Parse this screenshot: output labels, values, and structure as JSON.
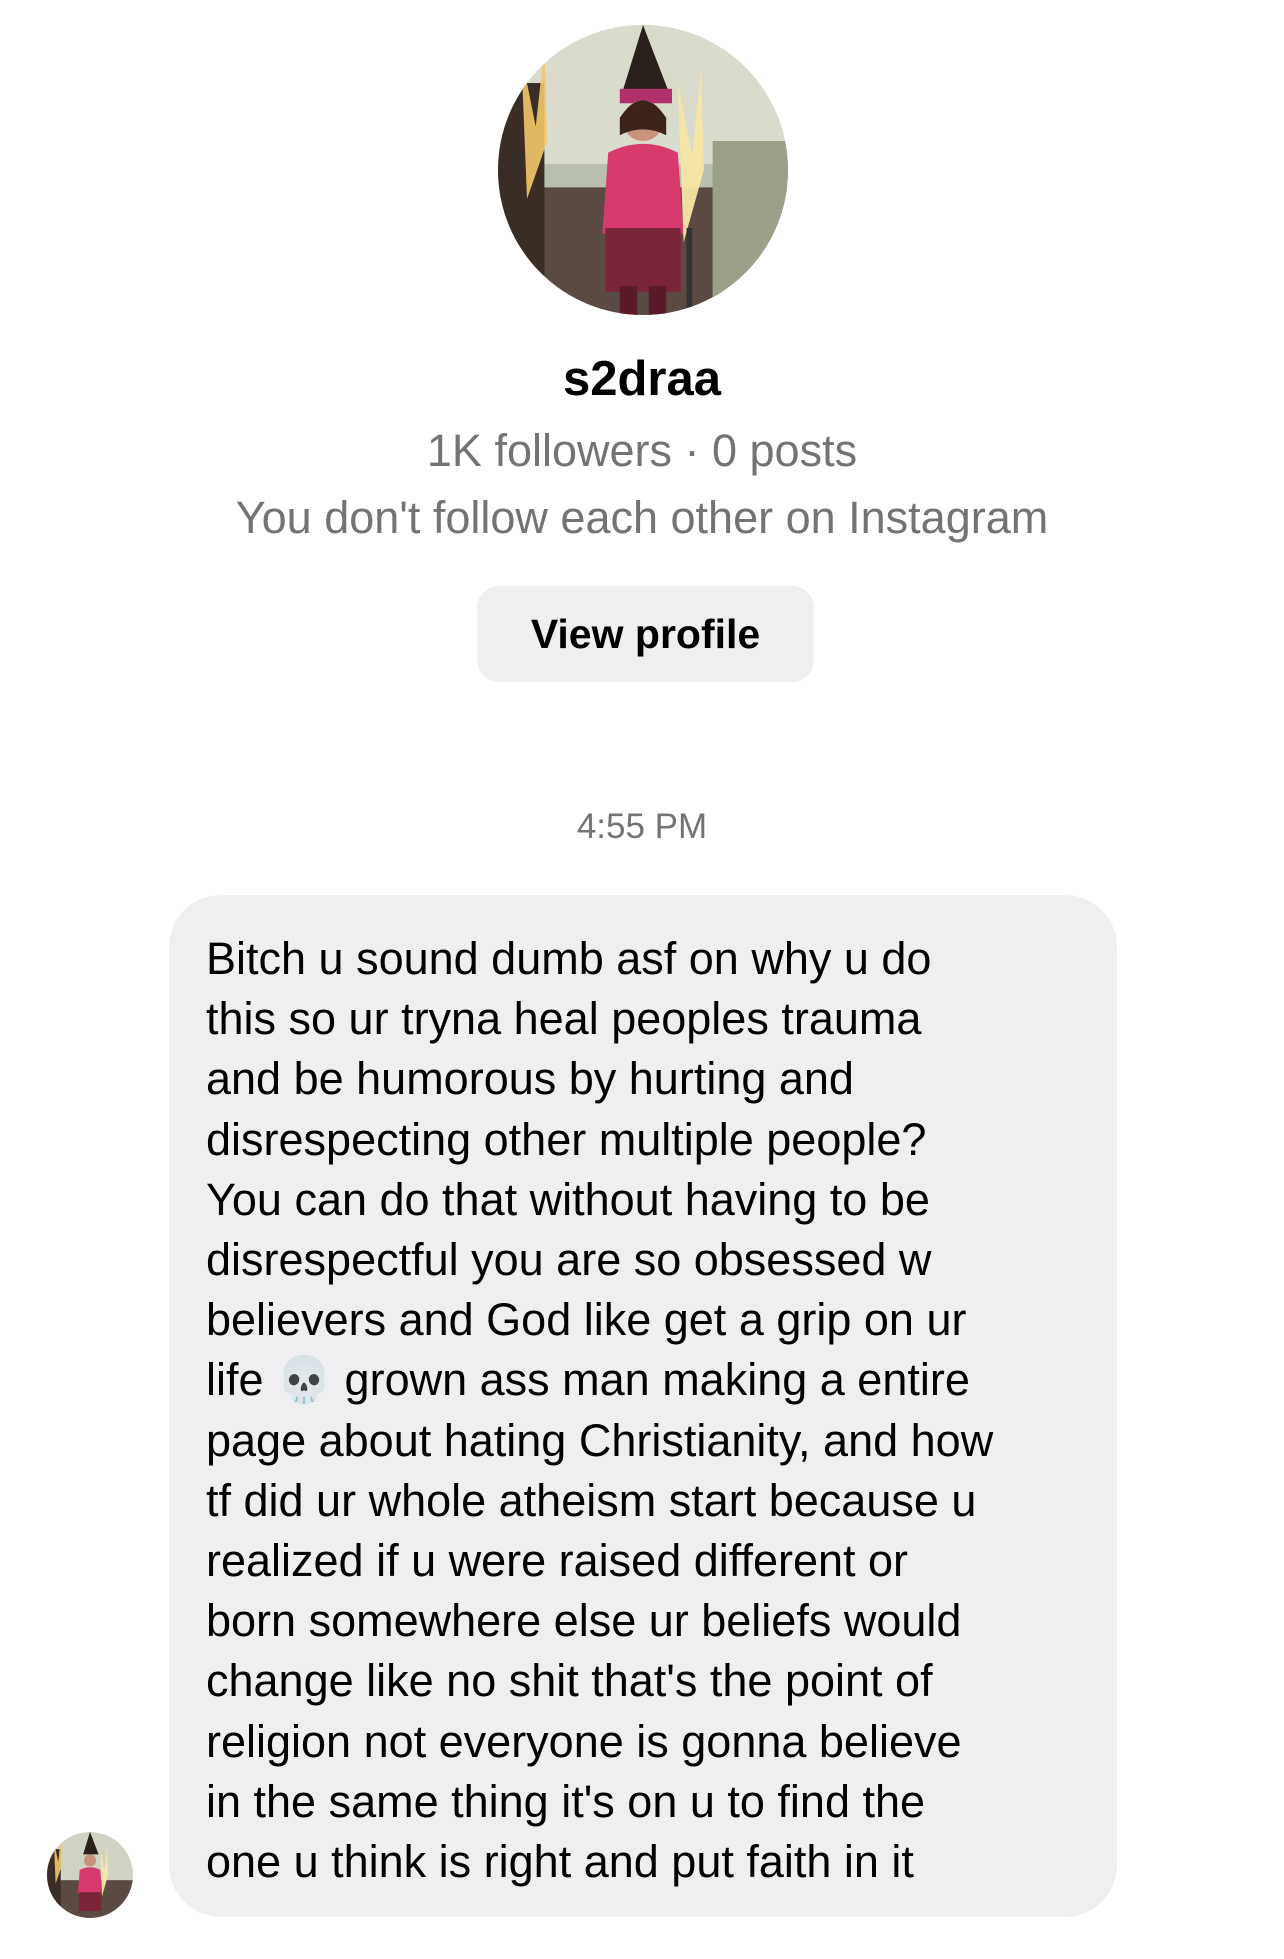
{
  "profile": {
    "username": "s2draa",
    "stats": "1K followers · 0 posts",
    "follow_status": "You don't follow each other on Instagram",
    "view_profile_label": "View profile"
  },
  "thread": {
    "timestamp": "4:55 PM",
    "messages": [
      {
        "sender": "s2draa",
        "text": "Bitch u sound dumb asf on why u do\nthis so ur tryna heal peoples trauma\nand be humorous by hurting and\ndisrespecting other multiple people?\nYou can do that without having to be\ndisrespectful you are so obsessed w\nbelievers and God like get a grip on ur\nlife 💀 grown ass man making a entire\npage about hating Christianity, and how\ntf did ur whole atheism start because u\nrealized if u were raised different or\nborn somewhere else ur beliefs would\nchange like no shit  that's the point of\nreligion not everyone is gonna believe\nin the same thing it's on u to find the\none u think is right and put faith in it"
      }
    ]
  },
  "colors": {
    "background": "#ffffff",
    "bubble": "#efeff1",
    "secondary_text": "#737373",
    "primary_text": "#000000"
  }
}
